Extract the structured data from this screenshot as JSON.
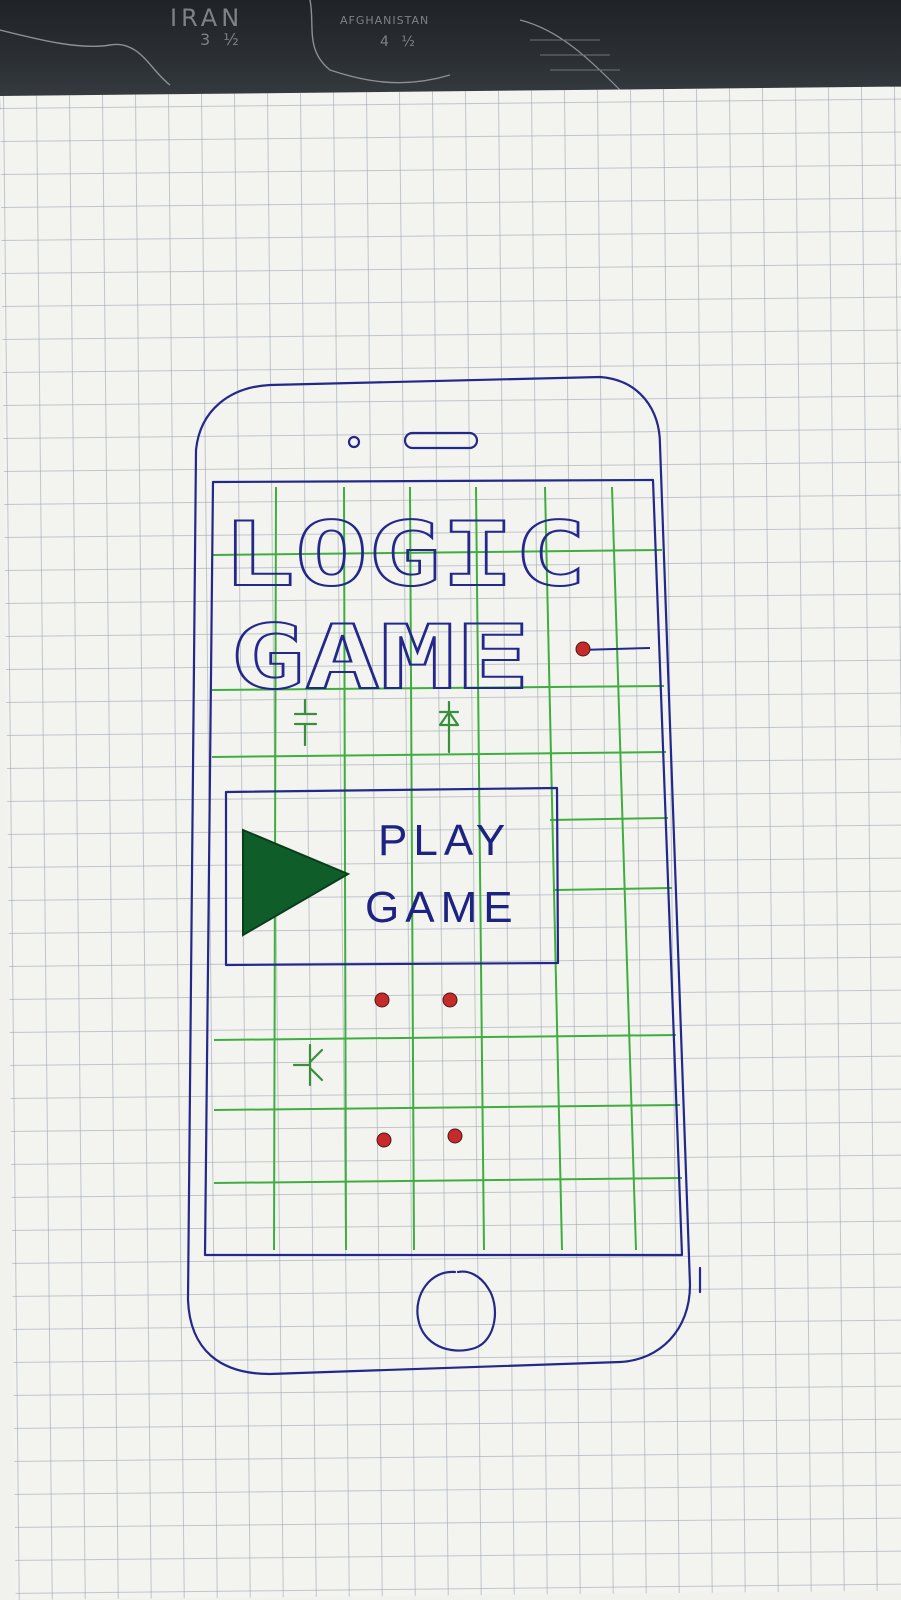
{
  "background": {
    "map_labels": [
      {
        "text": "IRAN"
      },
      {
        "text": "3 ½"
      },
      {
        "text": "AFGHANISTAN"
      },
      {
        "text": "4 ½"
      }
    ]
  },
  "app": {
    "title_line1": "LOGIC",
    "title_line2": "GAME",
    "play_button": {
      "line1": "PLAY",
      "line2": "GAME",
      "icon": "play-icon"
    }
  },
  "colors": {
    "ink": "#23288a",
    "circuit_grid": "#3fae3f",
    "play_icon": "#0f5e2a",
    "node_dot": "#c62a2a"
  }
}
